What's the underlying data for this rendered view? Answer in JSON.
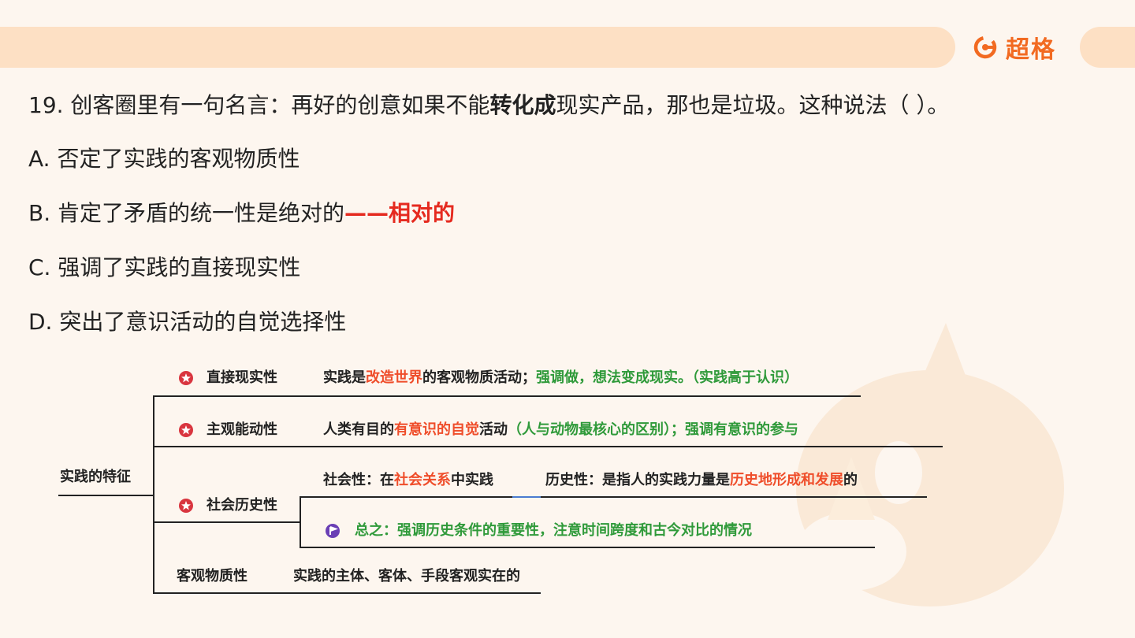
{
  "brand": {
    "name": "超格",
    "icon": "chaoge-logo-icon"
  },
  "question": {
    "prefix": "19. 创客圈里有一句名言：再好的创意如果不能",
    "bold": "转化成",
    "suffix": "现实产品，那也是垃圾。这种说法（ ）。"
  },
  "options": {
    "a": "A. 否定了实践的客观物质性",
    "b": "B. 肯定了矛盾的统一性是绝对的",
    "b_note": "——相对的",
    "c": "C. 强调了实践的直接现实性",
    "d": "D. 突出了意识活动的自觉选择性"
  },
  "mindmap": {
    "root": "实践的特征",
    "branch1": {
      "label": "直接现实性",
      "d1": "实践是",
      "d2": "改造世界",
      "d3": "的客观物质活动；",
      "d4": "强调做，想法变成现实。（实践高于认识）"
    },
    "branch2": {
      "label": "主观能动性",
      "d1": "人类有目的",
      "d2": "有意识的自觉",
      "d3": "活动",
      "d4": "（人与动物最核心的区别）；强调有意识的参与"
    },
    "branch3": {
      "label": "社会历史性",
      "s1": "社会性：在",
      "s2": "社会关系",
      "s3": "中实践",
      "h1": "历史性：是指人的实践力量是",
      "h2": "历史地形成和发展",
      "h3": "的",
      "summary": "总之：强调历史条件的重要性，注意时间跨度和古今对比的情况"
    },
    "branch4": {
      "label": "客观物质性",
      "detail": "实践的主体、客体、手段客观实在的"
    }
  },
  "colors": {
    "accent": "#f26a21",
    "bar": "#fde0c4",
    "red": "#e52a1f",
    "green": "#2f9a3a",
    "orange": "#ef4d2a"
  }
}
